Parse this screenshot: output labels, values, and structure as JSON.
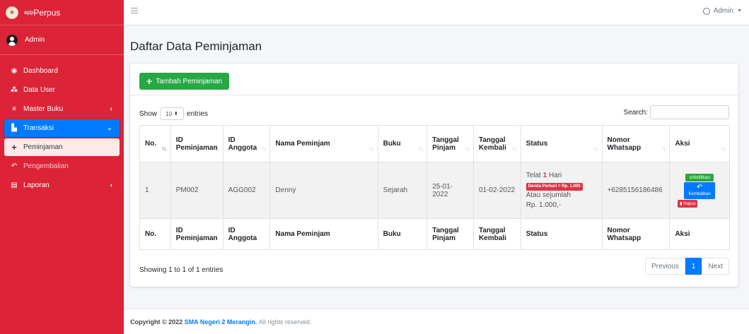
{
  "brand": {
    "prefix": "app",
    "name": "Perpus"
  },
  "user": {
    "name": "Admin"
  },
  "sidebar": {
    "items": [
      {
        "label": "Dashboard",
        "icon": "tachometer-icon",
        "glyph": "◉"
      },
      {
        "label": "Data User",
        "icon": "users-icon",
        "glyph": "⁂"
      },
      {
        "label": "Master Buku",
        "icon": "database-icon",
        "glyph": "≡"
      },
      {
        "label": "Transaksi",
        "icon": "chart-area-icon",
        "glyph": "▙"
      },
      {
        "label": "Peminjaman",
        "icon": "plus-icon",
        "glyph": "+"
      },
      {
        "label": "Pengembalian",
        "icon": "undo-icon",
        "glyph": "↶"
      },
      {
        "label": "Laporan",
        "icon": "file-icon",
        "glyph": "▤"
      }
    ]
  },
  "topbar": {
    "user_label": "Admin"
  },
  "page": {
    "title": "Daftar Data Peminjaman"
  },
  "toolbar": {
    "add_label": "Tambah Peminjaman"
  },
  "table_controls": {
    "show_label": "Show",
    "entries_value": "10",
    "entries_label": "entries",
    "search_label": "Search:"
  },
  "table": {
    "headers": [
      "No.",
      "ID Peminjaman",
      "ID Anggota",
      "Nama Peminjam",
      "Buku",
      "Tanggal Pinjam",
      "Tanggal Kembali",
      "Status",
      "Nomor Whatsapp",
      "Aksi"
    ],
    "rows": [
      {
        "no": "1",
        "id_peminjaman": "PM002",
        "id_anggota": "AGG002",
        "nama": "Denny",
        "buku": "Sejarah",
        "tgl_pinjam": "25-01-2022",
        "tgl_kembali": "01-02-2022",
        "status": {
          "telat_prefix": "Telat",
          "telat_days": "1",
          "telat_suffix": "Hari",
          "denda_badge": "Denda Perhari = Rp. 1.000",
          "line3": "Atau sejumlah",
          "line4": "Rp. 1.000,-"
        },
        "whatsapp": "+6285156186486",
        "actions": {
          "notif": "Notifikasi",
          "kembali": "Kembalikan",
          "hapus": "Hapus"
        }
      }
    ]
  },
  "info": "Showing 1 to 1 of 1 entries",
  "pagination": {
    "prev": "Previous",
    "current": "1",
    "next": "Next"
  },
  "footer": {
    "prefix": "Copyright © 2022",
    "school": "SMA Negeri 2 Merangin.",
    "suffix": "All rights reserved."
  },
  "colors": {
    "sidebar": "#dc2338",
    "accent": "#007bff",
    "success": "#28a745",
    "danger": "#dc3545"
  }
}
